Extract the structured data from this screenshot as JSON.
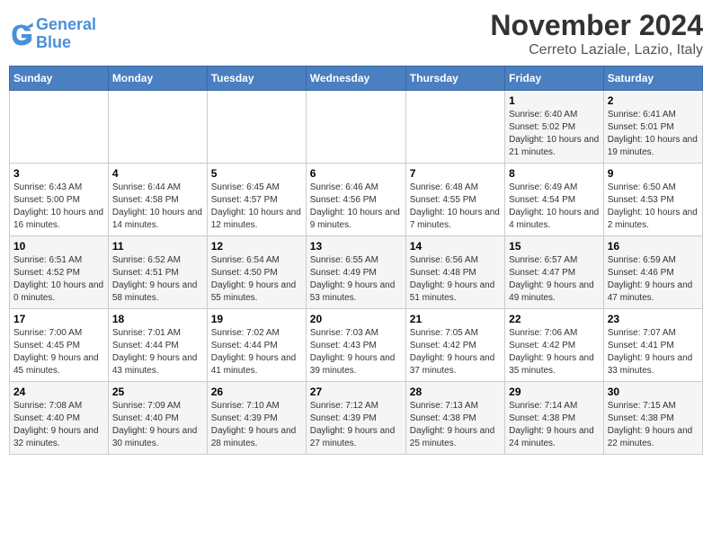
{
  "logo": {
    "line1": "General",
    "line2": "Blue"
  },
  "title": "November 2024",
  "location": "Cerreto Laziale, Lazio, Italy",
  "weekdays": [
    "Sunday",
    "Monday",
    "Tuesday",
    "Wednesday",
    "Thursday",
    "Friday",
    "Saturday"
  ],
  "weeks": [
    [
      {
        "day": "",
        "info": ""
      },
      {
        "day": "",
        "info": ""
      },
      {
        "day": "",
        "info": ""
      },
      {
        "day": "",
        "info": ""
      },
      {
        "day": "",
        "info": ""
      },
      {
        "day": "1",
        "info": "Sunrise: 6:40 AM\nSunset: 5:02 PM\nDaylight: 10 hours and 21 minutes."
      },
      {
        "day": "2",
        "info": "Sunrise: 6:41 AM\nSunset: 5:01 PM\nDaylight: 10 hours and 19 minutes."
      }
    ],
    [
      {
        "day": "3",
        "info": "Sunrise: 6:43 AM\nSunset: 5:00 PM\nDaylight: 10 hours and 16 minutes."
      },
      {
        "day": "4",
        "info": "Sunrise: 6:44 AM\nSunset: 4:58 PM\nDaylight: 10 hours and 14 minutes."
      },
      {
        "day": "5",
        "info": "Sunrise: 6:45 AM\nSunset: 4:57 PM\nDaylight: 10 hours and 12 minutes."
      },
      {
        "day": "6",
        "info": "Sunrise: 6:46 AM\nSunset: 4:56 PM\nDaylight: 10 hours and 9 minutes."
      },
      {
        "day": "7",
        "info": "Sunrise: 6:48 AM\nSunset: 4:55 PM\nDaylight: 10 hours and 7 minutes."
      },
      {
        "day": "8",
        "info": "Sunrise: 6:49 AM\nSunset: 4:54 PM\nDaylight: 10 hours and 4 minutes."
      },
      {
        "day": "9",
        "info": "Sunrise: 6:50 AM\nSunset: 4:53 PM\nDaylight: 10 hours and 2 minutes."
      }
    ],
    [
      {
        "day": "10",
        "info": "Sunrise: 6:51 AM\nSunset: 4:52 PM\nDaylight: 10 hours and 0 minutes."
      },
      {
        "day": "11",
        "info": "Sunrise: 6:52 AM\nSunset: 4:51 PM\nDaylight: 9 hours and 58 minutes."
      },
      {
        "day": "12",
        "info": "Sunrise: 6:54 AM\nSunset: 4:50 PM\nDaylight: 9 hours and 55 minutes."
      },
      {
        "day": "13",
        "info": "Sunrise: 6:55 AM\nSunset: 4:49 PM\nDaylight: 9 hours and 53 minutes."
      },
      {
        "day": "14",
        "info": "Sunrise: 6:56 AM\nSunset: 4:48 PM\nDaylight: 9 hours and 51 minutes."
      },
      {
        "day": "15",
        "info": "Sunrise: 6:57 AM\nSunset: 4:47 PM\nDaylight: 9 hours and 49 minutes."
      },
      {
        "day": "16",
        "info": "Sunrise: 6:59 AM\nSunset: 4:46 PM\nDaylight: 9 hours and 47 minutes."
      }
    ],
    [
      {
        "day": "17",
        "info": "Sunrise: 7:00 AM\nSunset: 4:45 PM\nDaylight: 9 hours and 45 minutes."
      },
      {
        "day": "18",
        "info": "Sunrise: 7:01 AM\nSunset: 4:44 PM\nDaylight: 9 hours and 43 minutes."
      },
      {
        "day": "19",
        "info": "Sunrise: 7:02 AM\nSunset: 4:44 PM\nDaylight: 9 hours and 41 minutes."
      },
      {
        "day": "20",
        "info": "Sunrise: 7:03 AM\nSunset: 4:43 PM\nDaylight: 9 hours and 39 minutes."
      },
      {
        "day": "21",
        "info": "Sunrise: 7:05 AM\nSunset: 4:42 PM\nDaylight: 9 hours and 37 minutes."
      },
      {
        "day": "22",
        "info": "Sunrise: 7:06 AM\nSunset: 4:42 PM\nDaylight: 9 hours and 35 minutes."
      },
      {
        "day": "23",
        "info": "Sunrise: 7:07 AM\nSunset: 4:41 PM\nDaylight: 9 hours and 33 minutes."
      }
    ],
    [
      {
        "day": "24",
        "info": "Sunrise: 7:08 AM\nSunset: 4:40 PM\nDaylight: 9 hours and 32 minutes."
      },
      {
        "day": "25",
        "info": "Sunrise: 7:09 AM\nSunset: 4:40 PM\nDaylight: 9 hours and 30 minutes."
      },
      {
        "day": "26",
        "info": "Sunrise: 7:10 AM\nSunset: 4:39 PM\nDaylight: 9 hours and 28 minutes."
      },
      {
        "day": "27",
        "info": "Sunrise: 7:12 AM\nSunset: 4:39 PM\nDaylight: 9 hours and 27 minutes."
      },
      {
        "day": "28",
        "info": "Sunrise: 7:13 AM\nSunset: 4:38 PM\nDaylight: 9 hours and 25 minutes."
      },
      {
        "day": "29",
        "info": "Sunrise: 7:14 AM\nSunset: 4:38 PM\nDaylight: 9 hours and 24 minutes."
      },
      {
        "day": "30",
        "info": "Sunrise: 7:15 AM\nSunset: 4:38 PM\nDaylight: 9 hours and 22 minutes."
      }
    ]
  ]
}
